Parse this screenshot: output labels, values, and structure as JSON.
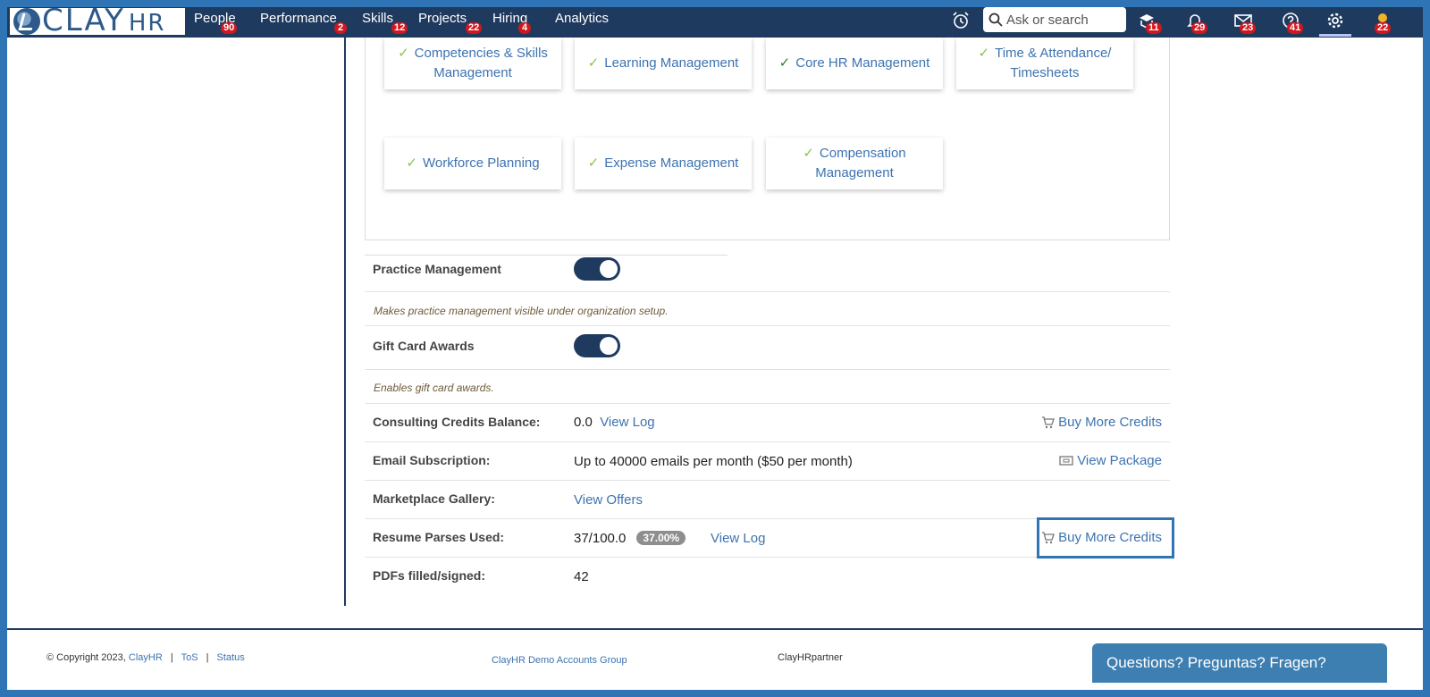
{
  "nav": {
    "logo_text": "CLAY",
    "logo_suffix": "HR",
    "items": [
      {
        "label": "People",
        "badge": "90"
      },
      {
        "label": "Performance",
        "badge": "2"
      },
      {
        "label": "Skills",
        "badge": "12"
      },
      {
        "label": "Projects",
        "badge": "22"
      },
      {
        "label": "Hiring",
        "badge": "4"
      },
      {
        "label": "Analytics",
        "badge": ""
      }
    ],
    "search_placeholder": "Ask or search",
    "icon_badges": {
      "learning": "11",
      "notifications": "29",
      "mail": "23",
      "help": "41",
      "profile": "22"
    }
  },
  "features": [
    {
      "label": "Competencies & Skills Management"
    },
    {
      "label": "Learning Management"
    },
    {
      "label": "Core HR Management"
    },
    {
      "label": "Time & Attendance/ Timesheets"
    },
    {
      "label": "Workforce Planning"
    },
    {
      "label": "Expense Management"
    },
    {
      "label": "Compensation Management"
    }
  ],
  "settings": {
    "practice_label": "Practice Management",
    "practice_desc": "Makes practice management visible under organization setup.",
    "practice_on": true,
    "giftcard_label": "Gift Card Awards",
    "giftcard_desc": "Enables gift card awards.",
    "giftcard_on": true,
    "consulting_label": "Consulting Credits Balance:",
    "consulting_value": "0.0",
    "consulting_link": "View Log",
    "consulting_action": "Buy More Credits",
    "email_label": "Email Subscription:",
    "email_value": "Up to 40000 emails per month ($50 per month)",
    "email_action": "View Package",
    "marketplace_label": "Marketplace Gallery:",
    "marketplace_link": "View Offers",
    "resume_label": "Resume Parses Used:",
    "resume_value": "37/100.0",
    "resume_pct": "37.00%",
    "resume_link": "View Log",
    "resume_action": "Buy More Credits",
    "pdfs_label": "PDFs filled/signed:",
    "pdfs_value": "42"
  },
  "footer": {
    "copyright": "© Copyright 2023,",
    "company": "ClayHR",
    "tos": "ToS",
    "status": "Status",
    "group": "ClayHR Demo Accounts Group",
    "partner": "ClayHRpartner",
    "questions": "Questions? Preguntas? Fragen?"
  },
  "colors": {
    "nav": "#1f3a5f",
    "link": "#3d73b0",
    "badge": "#d2161e",
    "frame": "#2f74b5"
  }
}
